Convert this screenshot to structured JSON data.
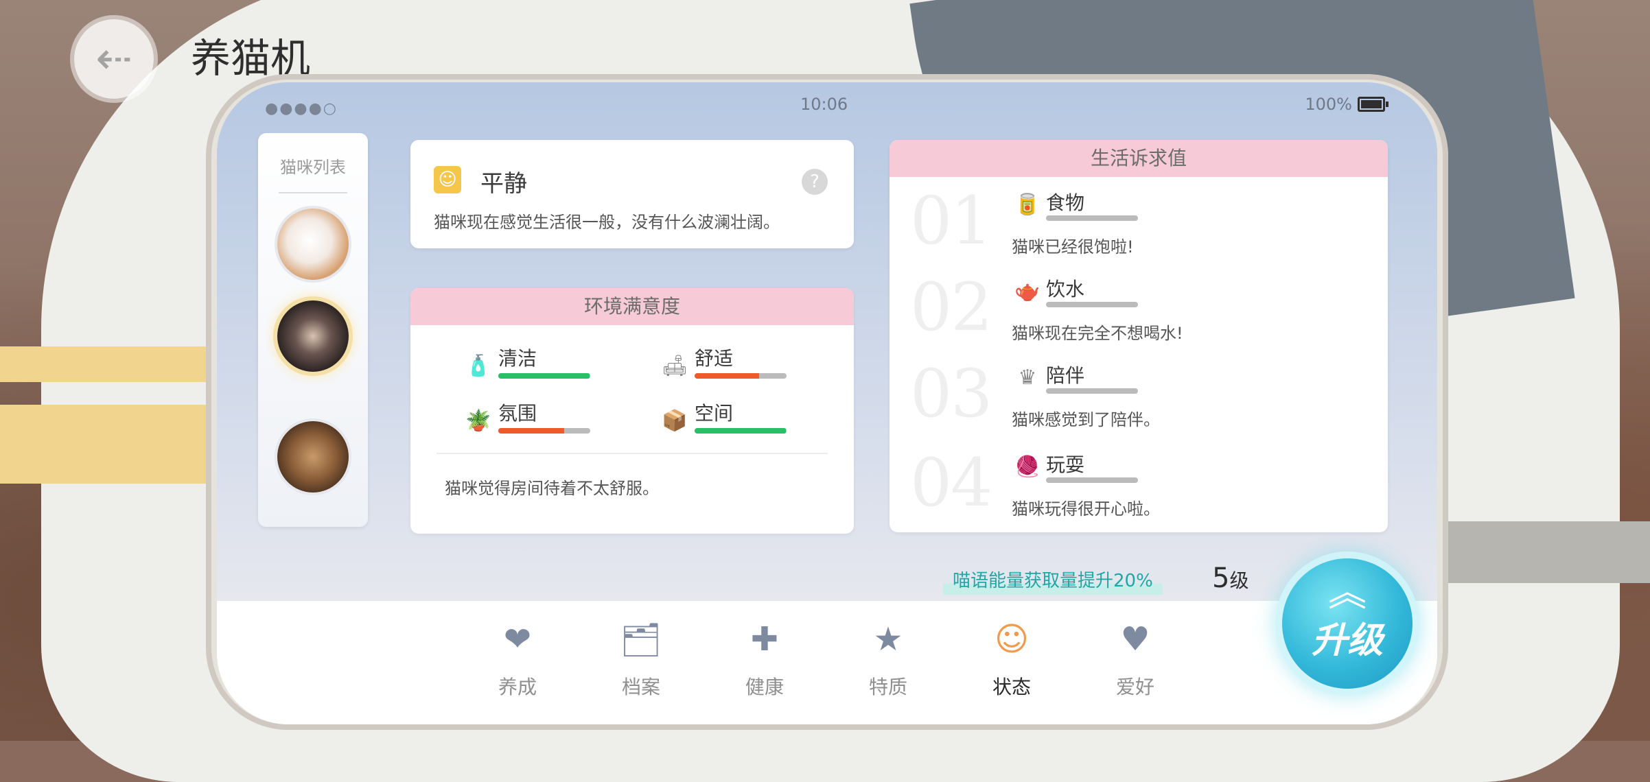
{
  "header": {
    "title": "养猫机",
    "back_icon": "back-arrow-icon"
  },
  "statusbar": {
    "signal": "●●●●○",
    "time": "10:06",
    "battery": "100%"
  },
  "cat_list": {
    "title": "猫咪列表"
  },
  "mood": {
    "title": "平静",
    "description": "猫咪现在感觉生活很一般，没有什么波澜壮阔。",
    "help": "?"
  },
  "environment": {
    "title": "环境满意度",
    "items": [
      {
        "label": "清洁",
        "value": 0.99,
        "color": "#29bf67"
      },
      {
        "label": "舒适",
        "value": 0.7,
        "color": "#ee5a2a"
      },
      {
        "label": "氛围",
        "value": 0.72,
        "color": "#ee5a2a"
      },
      {
        "label": "空间",
        "value": 0.99,
        "color": "#29bf67"
      }
    ],
    "description": "猫咪觉得房间待着不太舒服。"
  },
  "life_needs": {
    "title": "生活诉求值",
    "items": [
      {
        "num": "01",
        "label": "食物",
        "value": 0.92,
        "desc": "猫咪已经很饱啦!"
      },
      {
        "num": "02",
        "label": "饮水",
        "value": 0.88,
        "desc": "猫咪现在完全不想喝水!"
      },
      {
        "num": "03",
        "label": "陪伴",
        "value": 1.0,
        "desc": "猫咪感觉到了陪伴。"
      },
      {
        "num": "04",
        "label": "玩耍",
        "value": 1.0,
        "desc": "猫咪玩得很开心啦。"
      }
    ]
  },
  "energy_tip": "喵语能量获取量提升20%",
  "level": {
    "number": "5",
    "unit": "级"
  },
  "nav": {
    "items": [
      {
        "label": "养成"
      },
      {
        "label": "档案"
      },
      {
        "label": "健康"
      },
      {
        "label": "特质"
      },
      {
        "label": "状态"
      },
      {
        "label": "爱好"
      }
    ]
  },
  "upgrade": {
    "label": "升级"
  },
  "colors": {
    "green": "#29bf67",
    "red": "#ee5a2a",
    "pink_header": "#f6cad6",
    "teal_tip": "#21a6a6",
    "upgrade": "#33b9d9"
  }
}
